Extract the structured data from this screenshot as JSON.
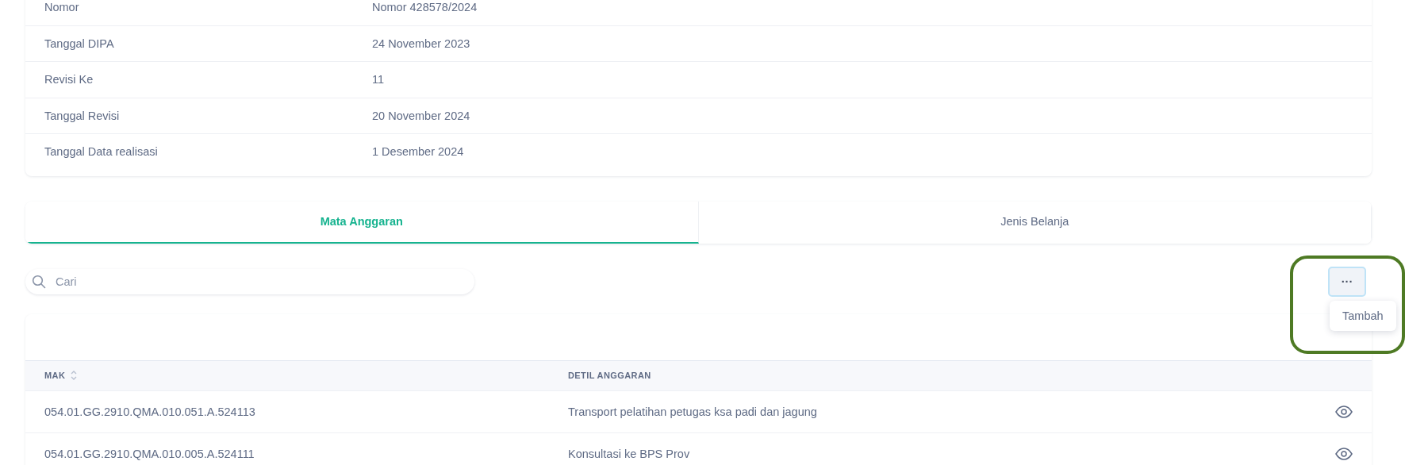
{
  "info_rows": [
    {
      "label": "Nomor",
      "value": "Nomor 428578/2024"
    },
    {
      "label": "Tanggal DIPA",
      "value": "24 November 2023"
    },
    {
      "label": "Revisi Ke",
      "value": "11"
    },
    {
      "label": "Tanggal Revisi",
      "value": "20 November 2024"
    },
    {
      "label": "Tanggal Data realisasi",
      "value": "1 Desember 2024"
    }
  ],
  "tabs": [
    {
      "label": "Mata Anggaran",
      "selected": true
    },
    {
      "label": "Jenis Belanja",
      "selected": false
    }
  ],
  "search": {
    "placeholder": "Cari"
  },
  "more_menu": {
    "button": "···",
    "items": [
      "Tambah"
    ],
    "highlighted": true
  },
  "table": {
    "columns": [
      {
        "label": "MAK",
        "sortable": true
      },
      {
        "label": "DETIL ANGGARAN",
        "sortable": false
      }
    ],
    "rows": [
      {
        "mak": "054.01.GG.2910.QMA.010.051.A.524113",
        "detil": "Transport pelatihan petugas ksa padi dan jagung"
      },
      {
        "mak": "054.01.GG.2910.QMA.010.005.A.524111",
        "detil": "Konsultasi ke BPS Prov"
      }
    ]
  }
}
